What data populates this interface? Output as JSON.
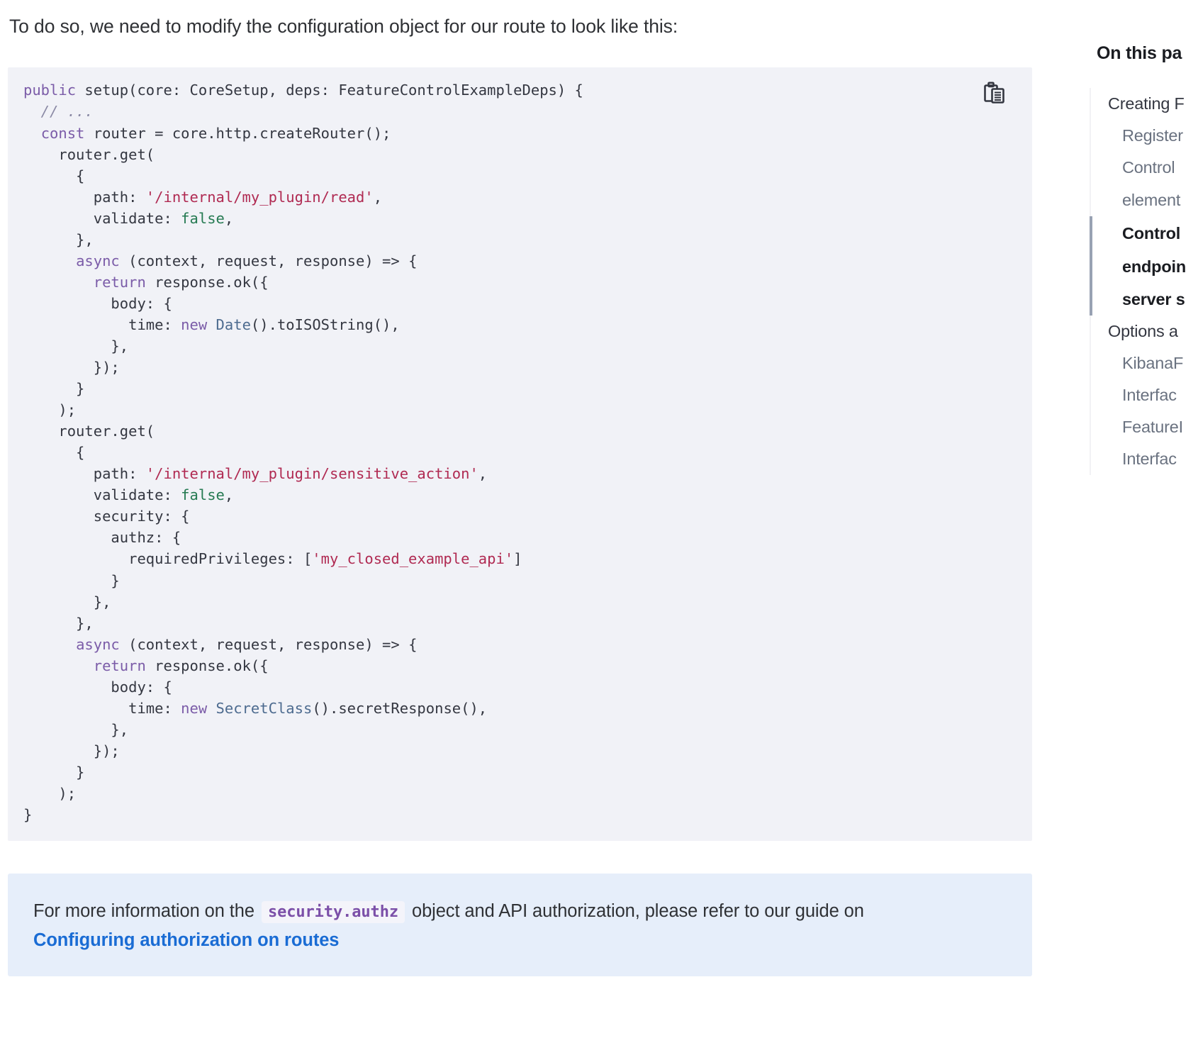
{
  "main": {
    "intro_paragraph": "To do so, we need to modify the configuration object for our route to look like this:",
    "code_block": {
      "language": "typescript",
      "copy_icon": "copy-clipboard-icon",
      "background_color": "#f1f2f7",
      "lines": [
        [
          {
            "t": "public",
            "c": "kw"
          },
          {
            "t": " setup(core: CoreSetup, deps: FeatureControlExampleDeps) {",
            "c": "plain"
          }
        ],
        [
          {
            "t": "  // ...",
            "c": "comment"
          }
        ],
        [
          {
            "t": "  ",
            "c": "plain"
          },
          {
            "t": "const",
            "c": "kw"
          },
          {
            "t": " router = core.http.createRouter();",
            "c": "plain"
          }
        ],
        [
          {
            "t": "    router.get(",
            "c": "plain"
          }
        ],
        [
          {
            "t": "      {",
            "c": "plain"
          }
        ],
        [
          {
            "t": "        path: ",
            "c": "plain"
          },
          {
            "t": "'/internal/my_plugin/read'",
            "c": "string"
          },
          {
            "t": ",",
            "c": "plain"
          }
        ],
        [
          {
            "t": "        validate: ",
            "c": "plain"
          },
          {
            "t": "false",
            "c": "bool"
          },
          {
            "t": ",",
            "c": "plain"
          }
        ],
        [
          {
            "t": "      },",
            "c": "plain"
          }
        ],
        [
          {
            "t": "      ",
            "c": "plain"
          },
          {
            "t": "async",
            "c": "kw"
          },
          {
            "t": " (context, request, response) => {",
            "c": "plain"
          }
        ],
        [
          {
            "t": "        ",
            "c": "plain"
          },
          {
            "t": "return",
            "c": "kw"
          },
          {
            "t": " response.ok({",
            "c": "plain"
          }
        ],
        [
          {
            "t": "          body: {",
            "c": "plain"
          }
        ],
        [
          {
            "t": "            time: ",
            "c": "plain"
          },
          {
            "t": "new",
            "c": "kw"
          },
          {
            "t": " ",
            "c": "plain"
          },
          {
            "t": "Date",
            "c": "class"
          },
          {
            "t": "().toISOString(),",
            "c": "plain"
          }
        ],
        [
          {
            "t": "          },",
            "c": "plain"
          }
        ],
        [
          {
            "t": "        });",
            "c": "plain"
          }
        ],
        [
          {
            "t": "      }",
            "c": "plain"
          }
        ],
        [
          {
            "t": "    );",
            "c": "plain"
          }
        ],
        [
          {
            "t": "    router.get(",
            "c": "plain"
          }
        ],
        [
          {
            "t": "      {",
            "c": "plain"
          }
        ],
        [
          {
            "t": "        path: ",
            "c": "plain"
          },
          {
            "t": "'/internal/my_plugin/sensitive_action'",
            "c": "string"
          },
          {
            "t": ",",
            "c": "plain"
          }
        ],
        [
          {
            "t": "        validate: ",
            "c": "plain"
          },
          {
            "t": "false",
            "c": "bool"
          },
          {
            "t": ",",
            "c": "plain"
          }
        ],
        [
          {
            "t": "        security: {",
            "c": "plain"
          }
        ],
        [
          {
            "t": "          authz: {",
            "c": "plain"
          }
        ],
        [
          {
            "t": "            requiredPrivileges: [",
            "c": "plain"
          },
          {
            "t": "'my_closed_example_api'",
            "c": "string"
          },
          {
            "t": "]",
            "c": "plain"
          }
        ],
        [
          {
            "t": "          }",
            "c": "plain"
          }
        ],
        [
          {
            "t": "        },",
            "c": "plain"
          }
        ],
        [
          {
            "t": "      },",
            "c": "plain"
          }
        ],
        [
          {
            "t": "      ",
            "c": "plain"
          },
          {
            "t": "async",
            "c": "kw"
          },
          {
            "t": " (context, request, response) => {",
            "c": "plain"
          }
        ],
        [
          {
            "t": "        ",
            "c": "plain"
          },
          {
            "t": "return",
            "c": "kw"
          },
          {
            "t": " response.ok({",
            "c": "plain"
          }
        ],
        [
          {
            "t": "          body: {",
            "c": "plain"
          }
        ],
        [
          {
            "t": "            time: ",
            "c": "plain"
          },
          {
            "t": "new",
            "c": "kw"
          },
          {
            "t": " ",
            "c": "plain"
          },
          {
            "t": "SecretClass",
            "c": "class"
          },
          {
            "t": "().secretResponse(),",
            "c": "plain"
          }
        ],
        [
          {
            "t": "          },",
            "c": "plain"
          }
        ],
        [
          {
            "t": "        });",
            "c": "plain"
          }
        ],
        [
          {
            "t": "      }",
            "c": "plain"
          }
        ],
        [
          {
            "t": "    );",
            "c": "plain"
          }
        ],
        [
          {
            "t": "}",
            "c": "plain"
          }
        ]
      ]
    },
    "callout": {
      "background_color": "#e6eefa",
      "text_before": "For more information on the",
      "inline_code": "security.authz",
      "text_after": "object and API authorization, please refer to our guide on",
      "link_label": "Configuring authorization on routes",
      "link_color": "#1a6cd4"
    }
  },
  "toc": {
    "title": "On this pa",
    "active_indicator_color": "#98a2b3",
    "items": [
      {
        "label": "Creating F",
        "level": 1,
        "active": false
      },
      {
        "label": "Register",
        "level": 2,
        "active": false
      },
      {
        "label": "Control",
        "level": 2,
        "active": false
      },
      {
        "label": "element",
        "level": 2,
        "active": false,
        "continuation": true
      },
      {
        "label": "Control",
        "level": 2,
        "active": true
      },
      {
        "label": "endpoin",
        "level": 2,
        "active": true,
        "continuation": true
      },
      {
        "label": "server s",
        "level": 2,
        "active": true,
        "continuation": true
      },
      {
        "label": "Options a",
        "level": 1,
        "active": false
      },
      {
        "label": "KibanaF",
        "level": 2,
        "active": false
      },
      {
        "label": "Interfac",
        "level": 2,
        "active": false
      },
      {
        "label": "FeatureI",
        "level": 2,
        "active": false
      },
      {
        "label": "Interfac",
        "level": 2,
        "active": false
      }
    ]
  }
}
